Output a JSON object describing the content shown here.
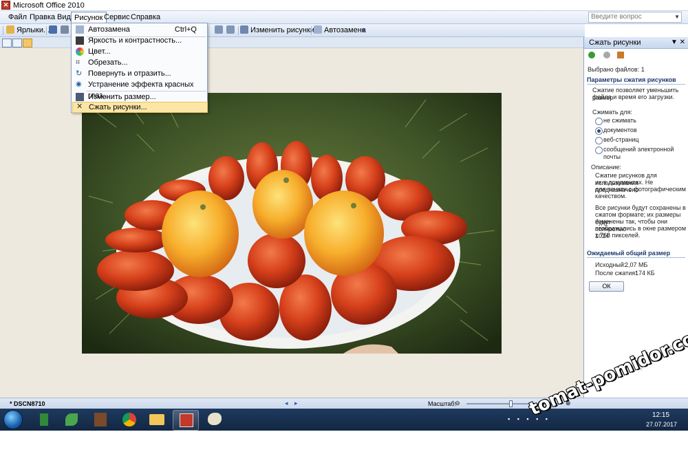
{
  "window": {
    "title": "Microsoft Office 2010"
  },
  "menubar": {
    "items": [
      "Файл",
      "Правка",
      "Вид",
      "Рисунок",
      "Сервис",
      "Справка"
    ],
    "help_placeholder": "Введите вопрос"
  },
  "toolbar": {
    "shortcuts_label": "Ярлыки...",
    "edit_pictures_label": "Изменить рисунки...",
    "autocorrect_label": "Автозамена"
  },
  "dropdown": {
    "items": [
      {
        "label": "Автозамена",
        "shortcut": "Ctrl+Q"
      },
      {
        "label": "Яркость и контрастность..."
      },
      {
        "label": "Цвет..."
      },
      {
        "label": "Обрезать..."
      },
      {
        "label": "Повернуть и отразить..."
      },
      {
        "label": "Устранение эффекта красных глаз..."
      },
      {
        "label": "Изменить размер..."
      },
      {
        "label": "Сжать рисунки..."
      }
    ]
  },
  "taskpane": {
    "title": "Сжать рисунки",
    "files_selected": "Выбрано файлов: 1",
    "section_params": "Параметры сжатия рисунков",
    "params_desc": [
      "Сжатие позволяет уменьшить размер",
      "файла и время его загрузки."
    ],
    "compress_for": "Сжимать для:",
    "options": [
      "не сжимать",
      "документов",
      "веб-страниц",
      "сообщений электронной почты"
    ],
    "selected_option": "документов",
    "desc_label": "Описание:",
    "desc_lines_1": [
      "Сжатие рисунков для использования",
      "их в документах. Не предназначено",
      "для печати с фотографическим",
      "качеством."
    ],
    "desc_lines_2": [
      "Все рисунки будут сохранены в",
      "сжатом формате; их размеры будут",
      "изменены так, чтобы они полностью",
      "отображались в окне размером 1024",
      "x 768 пикселей."
    ],
    "section_size": "Ожидаемый общий размер",
    "original_label": "Исходный:",
    "original_value": "2,07 МБ",
    "after_label": "После сжатия:",
    "after_value": "174 КБ",
    "ok_label": "ОК"
  },
  "statusbar": {
    "file_name": "* DSCN8710",
    "zoom_label": "Масштаб:",
    "zoom_level": 0.47
  },
  "taskbar": {
    "time": "12:15",
    "date": "27.07.2017"
  },
  "watermark": "tomat-pomidor.com",
  "colors": {
    "accent": "#fbe6a6",
    "menu_border": "#8da0c3",
    "pane_heading": "#1c3a6c"
  }
}
